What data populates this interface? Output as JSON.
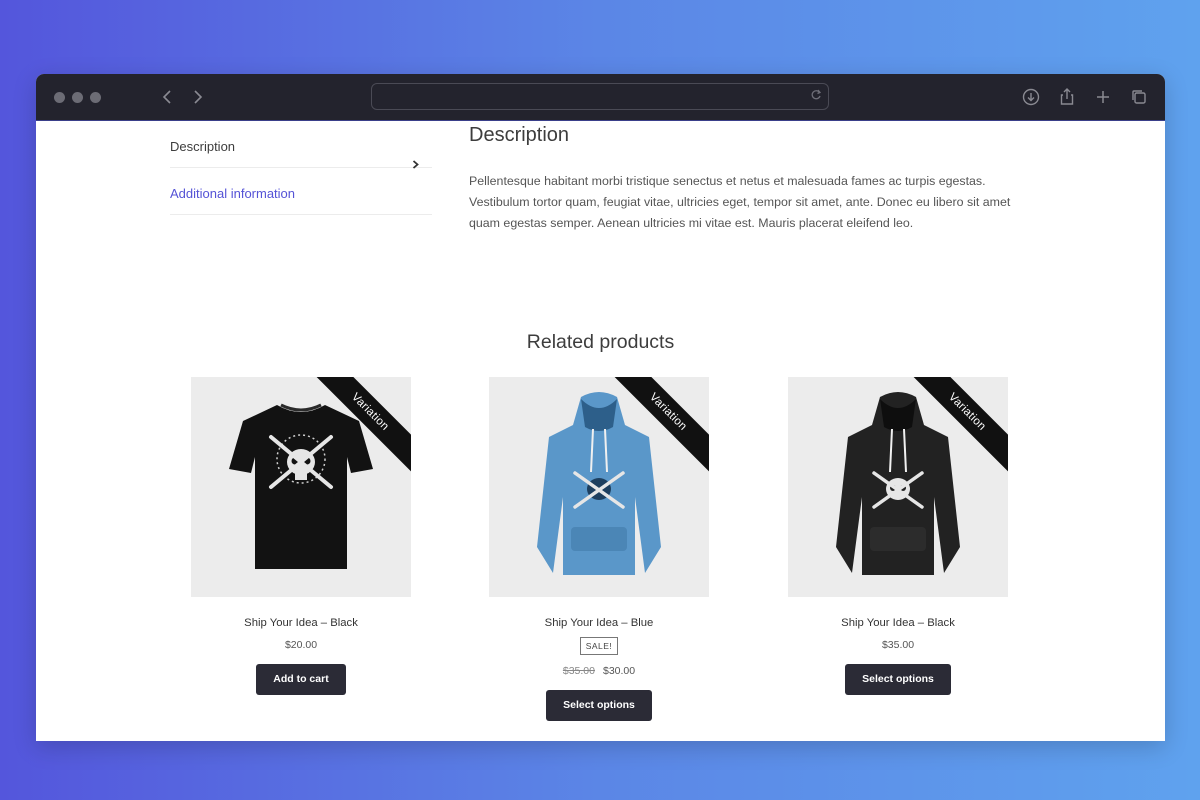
{
  "tabs": [
    {
      "label": "Description"
    },
    {
      "label": "Additional information"
    }
  ],
  "description": {
    "title": "Description",
    "body": "Pellentesque habitant morbi tristique senectus et netus et malesuada fames ac turpis egestas. Vestibulum tortor quam, feugiat vitae, ultricies eget, tempor sit amet, ante. Donec eu libero sit amet quam egestas semper. Aenean ultricies mi vitae est. Mauris placerat eleifend leo."
  },
  "related": {
    "title": "Related products",
    "products": [
      {
        "name": "Ship Your Idea – Black",
        "badge": "Variation",
        "price": "$20.00",
        "old_price": "",
        "sale_label": "",
        "button": "Add to cart",
        "garment": "tshirt",
        "color": "#121212"
      },
      {
        "name": "Ship Your Idea – Blue",
        "badge": "Variation",
        "price": "$30.00",
        "old_price": "$35.00",
        "sale_label": "SALE!",
        "button": "Select options",
        "garment": "hoodie",
        "color": "#5a97c9"
      },
      {
        "name": "Ship Your Idea – Black",
        "badge": "Variation",
        "price": "$35.00",
        "old_price": "",
        "sale_label": "",
        "button": "Select options",
        "garment": "hoodie",
        "color": "#222222"
      }
    ]
  },
  "colors": {
    "accent": "#5553d6",
    "button": "#2b2b36"
  }
}
